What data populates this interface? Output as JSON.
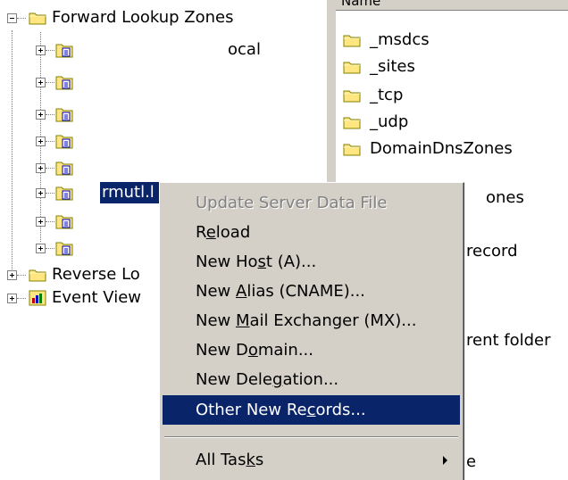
{
  "tree": {
    "forward_zones": "Forward Lookup Zones",
    "zone1_suffix": "ocal",
    "zone6_label": "rmutl.l",
    "reverse_zones": "Reverse Lo",
    "event_viewer": "Event View"
  },
  "list": {
    "header": "Name",
    "items": [
      "_msdcs",
      "_sites",
      "_tcp",
      "_udp",
      "DomainDnsZones"
    ],
    "partial_1": "ones",
    "partial_2": "record",
    "partial_3": "rent folder",
    "partial_4": "e"
  },
  "menu": {
    "update_server_data_file": "Update Server Data File",
    "reload": {
      "pre": "R",
      "key": "e",
      "post": "load"
    },
    "new_host": {
      "pre": "New Ho",
      "key": "s",
      "post": "t (A)..."
    },
    "new_alias": {
      "pre": "New ",
      "key": "A",
      "post": "lias (CNAME)..."
    },
    "new_mx": {
      "pre": "New ",
      "key": "M",
      "post": "ail Exchanger (MX)..."
    },
    "new_domain": {
      "pre": "New D",
      "key": "o",
      "post": "main..."
    },
    "new_delegation": {
      "pre": "New Dele",
      "key": "g",
      "post": "ation..."
    },
    "other_records": {
      "pre": "Other New Re",
      "key": "c",
      "post": "ords..."
    },
    "all_tasks": {
      "pre": "All Tas",
      "key": "k",
      "post": "s"
    }
  },
  "colors": {
    "selection": "#0a246a",
    "menu_bg": "#d4d0c8",
    "folder": "#ffe680"
  }
}
